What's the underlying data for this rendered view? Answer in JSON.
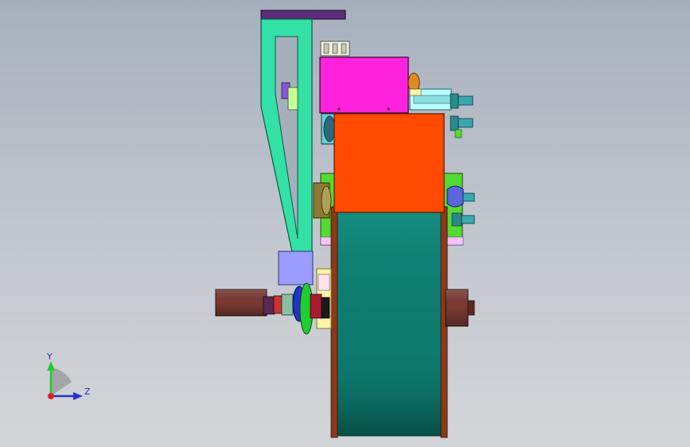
{
  "viewport": {
    "background_top": "#a6b0bd",
    "background_bottom": "#d3d5d8"
  },
  "model": {
    "colors": {
      "top_bar": "#5b2c7a",
      "bracket": "#33e0a6",
      "magenta_box": "#ff22dd",
      "orange_block": "#ff4a00",
      "teal_drum": "#0d7a6e",
      "drum_rim": "#8a3a1a",
      "lavender_block": "#9a9cff",
      "green_plate": "#55d933",
      "shaft": "#7a3a33",
      "cyan_part": "#b8ffff",
      "cream_part": "#fff3a8",
      "blue_part": "#2233cc",
      "green_gear": "#22cc33",
      "olive_part": "#8a7a33"
    }
  },
  "triad": {
    "y_label": "Y",
    "z_label": "Z",
    "icon": "coordinate-triad-icon"
  }
}
